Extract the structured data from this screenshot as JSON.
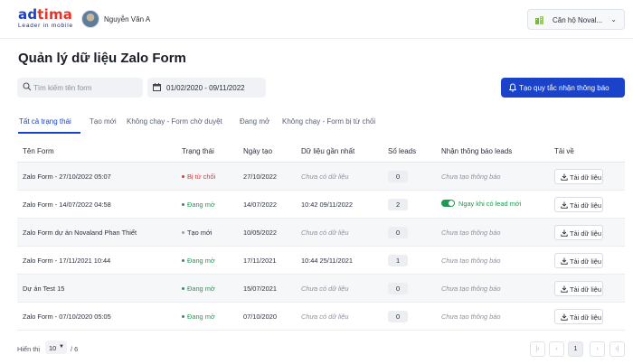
{
  "header": {
    "logo_text_ad": "ad",
    "logo_text_tima": "tima",
    "logo_tagline": "Leader in mobile",
    "user_name": "Nguyễn Văn A",
    "project_label": "Căn hộ Noval...",
    "project_icon": "building-icon"
  },
  "page": {
    "title": "Quản lý dữ liệu Zalo Form"
  },
  "toolbar": {
    "search_placeholder": "Tìm kiếm tên form",
    "date_range": "01/02/2020 - 09/11/2022",
    "create_rule_label": "Tạo quy tắc nhận thông báo"
  },
  "tabs": [
    {
      "label": "Tất cả trạng thái",
      "active": true
    },
    {
      "label": "Tạo mới",
      "active": false
    },
    {
      "label": "Không chạy - Form chờ duyệt",
      "active": false
    },
    {
      "label": "Đang mở",
      "active": false
    },
    {
      "label": "Không chạy - Form bị từ chối",
      "active": false
    }
  ],
  "table": {
    "columns": [
      "Tên Form",
      "Trạng thái",
      "Ngày tạo",
      "Dữ liệu gần nhất",
      "Số leads",
      "Nhận thông báo leads",
      "Tải về"
    ],
    "rows": [
      {
        "name": "Zalo Form - 27/10/2022 05:07",
        "status": "Bị từ chối",
        "status_kind": "rejected",
        "created": "27/10/2022",
        "latest": "Chưa có dữ liệu",
        "latest_empty": true,
        "leads": "0",
        "notify": "Chưa tạo thông báo",
        "notify_on": false,
        "download": "Tải dữ liệu"
      },
      {
        "name": "Zalo Form - 14/07/2022 04:58",
        "status": "Đang mở",
        "status_kind": "open",
        "created": "14/07/2022",
        "latest": "10:42 09/11/2022",
        "latest_empty": false,
        "leads": "2",
        "notify": "Ngay khi có lead mới",
        "notify_on": true,
        "download": "Tải dữ liệu"
      },
      {
        "name": "Zalo Form dự án Novaland Phan Thiết",
        "status": "Tạo mới",
        "status_kind": "new",
        "created": "10/05/2022",
        "latest": "Chưa có dữ liệu",
        "latest_empty": true,
        "leads": "0",
        "notify": "Chưa tạo thông báo",
        "notify_on": false,
        "download": "Tải dữ liệu"
      },
      {
        "name": "Zalo Form - 17/11/2021 10:44",
        "status": "Đang mở",
        "status_kind": "open",
        "created": "17/11/2021",
        "latest": "10:44 25/11/2021",
        "latest_empty": false,
        "leads": "1",
        "notify": "Chưa tạo thông báo",
        "notify_on": false,
        "download": "Tải dữ liệu"
      },
      {
        "name": "Dự án Test 15",
        "status": "Đang mở",
        "status_kind": "open",
        "created": "15/07/2021",
        "latest": "Chưa có dữ liệu",
        "latest_empty": true,
        "leads": "0",
        "notify": "Chưa tạo thông báo",
        "notify_on": false,
        "download": "Tải dữ liệu"
      },
      {
        "name": "Zalo Form - 07/10/2020 05:05",
        "status": "Đang mở",
        "status_kind": "open",
        "created": "07/10/2020",
        "latest": "Chưa có dữ liệu",
        "latest_empty": true,
        "leads": "0",
        "notify": "Chưa tạo thông báo",
        "notify_on": false,
        "download": "Tải dữ liệu"
      }
    ]
  },
  "footer": {
    "show_label": "Hiển thị",
    "page_size": "10",
    "page_total": "/ 6",
    "current_page": "1",
    "pager_first": "|‹",
    "pager_prev": "‹",
    "pager_next": "›",
    "pager_last": "›|"
  },
  "colors": {
    "primary": "#1a43c9",
    "open": "#1f9a52",
    "rejected": "#d23a3a"
  }
}
